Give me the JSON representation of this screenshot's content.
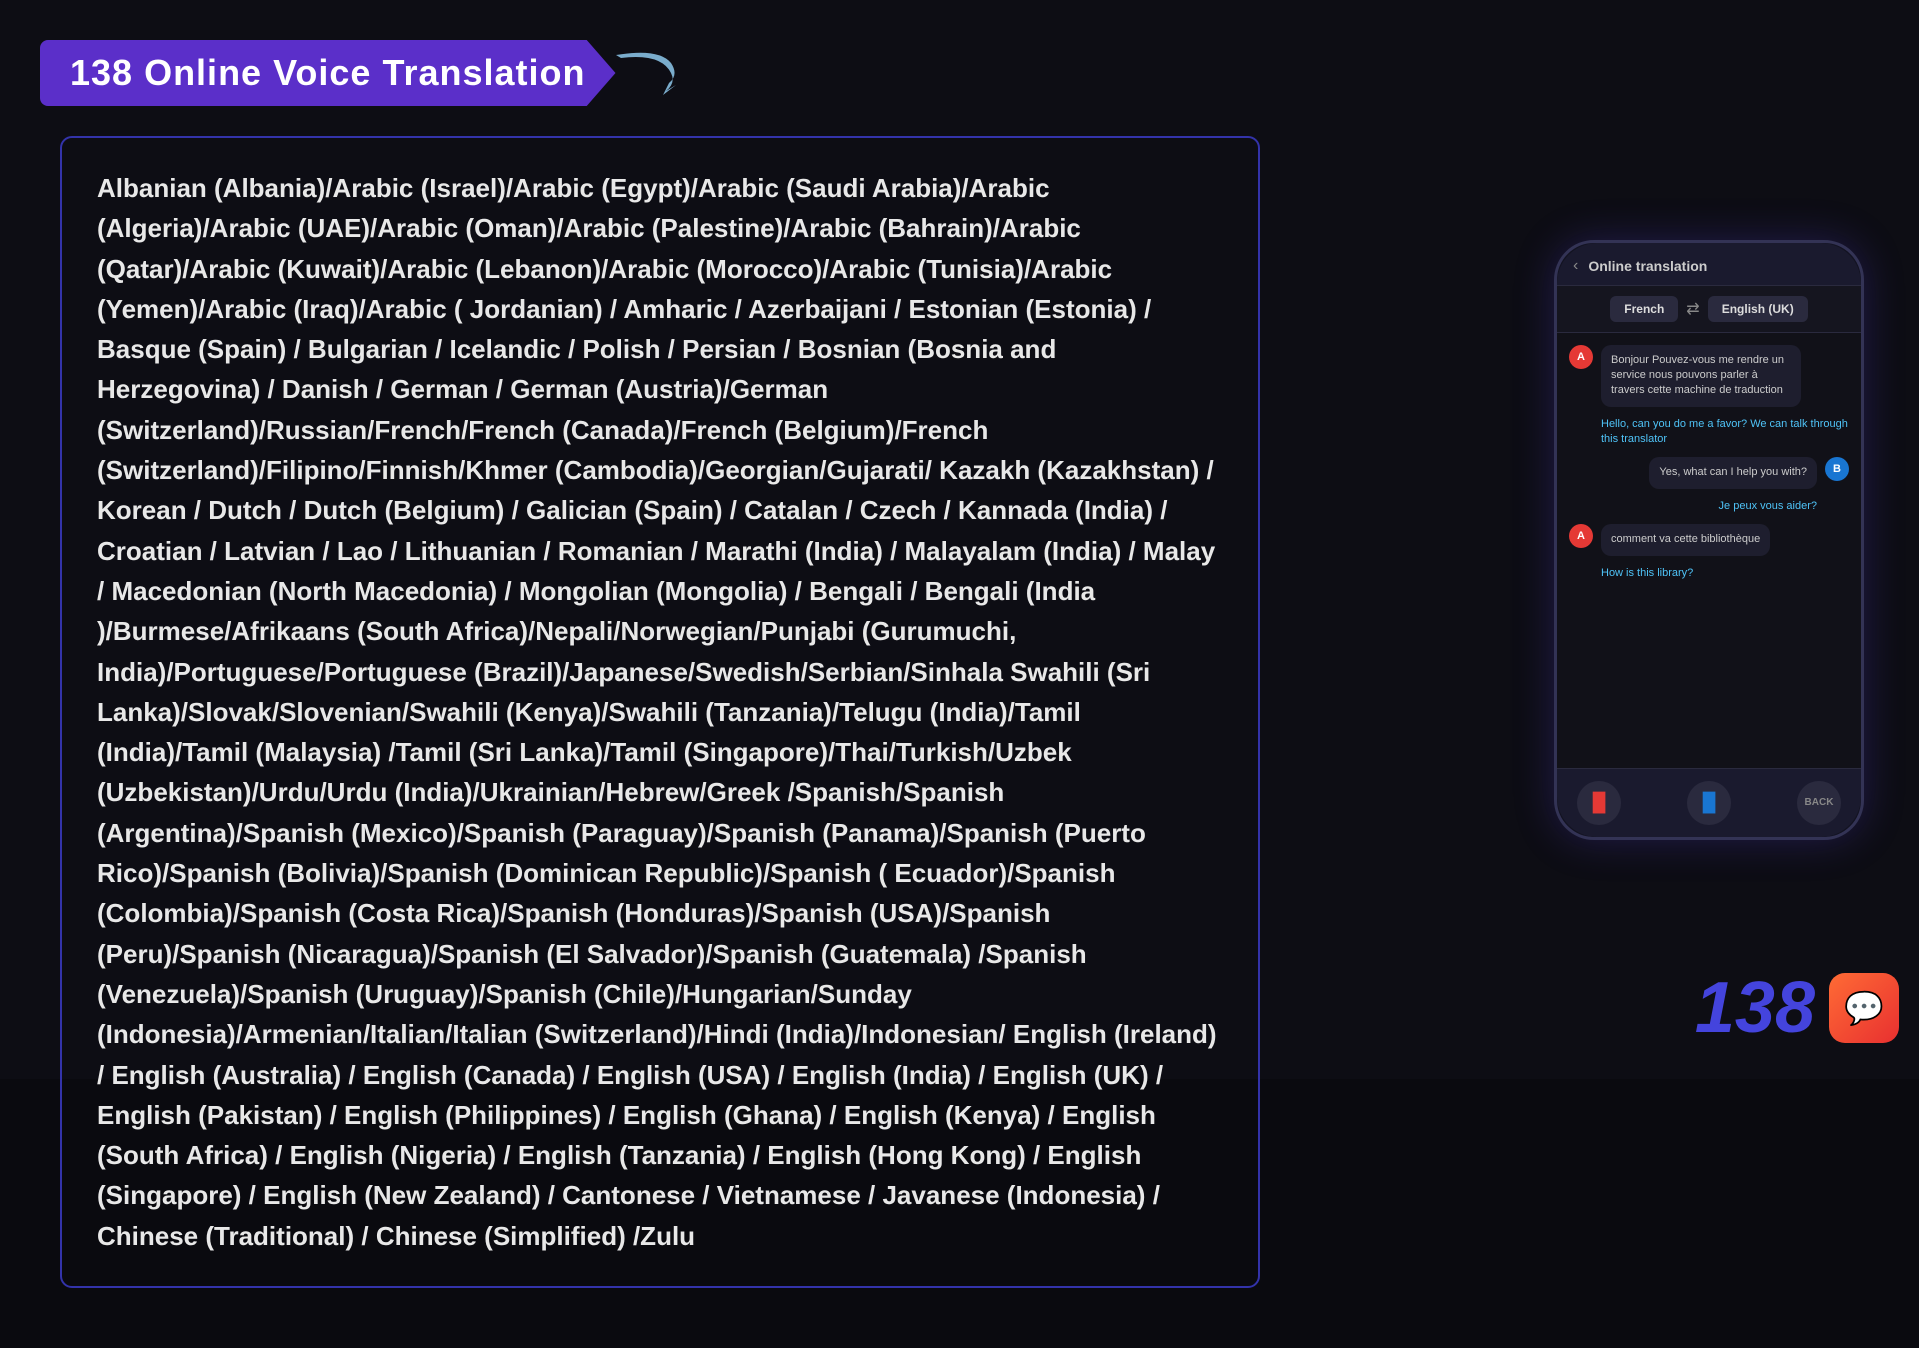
{
  "title": "138 Online Voice Translation",
  "languages_text": "Albanian (Albania)/Arabic (Israel)/Arabic (Egypt)/Arabic (Saudi Arabia)/Arabic (Algeria)/Arabic (UAE)/Arabic (Oman)/Arabic (Palestine)/Arabic (Bahrain)/Arabic (Qatar)/Arabic (Kuwait)/Arabic (Lebanon)/Arabic (Morocco)/Arabic (Tunisia)/Arabic (Yemen)/Arabic (Iraq)/Arabic ( Jordanian) / Amharic / Azerbaijani / Estonian (Estonia) / Basque (Spain) / Bulgarian / Icelandic / Polish / Persian / Bosnian (Bosnia and Herzegovina) / Danish / German / German (Austria)/German (Switzerland)/Russian/French/French (Canada)/French (Belgium)/French (Switzerland)/Filipino/Finnish/Khmer (Cambodia)/Georgian/Gujarati/ Kazakh (Kazakhstan) / Korean / Dutch / Dutch (Belgium) / Galician (Spain) / Catalan / Czech / Kannada (India) / Croatian / Latvian / Lao / Lithuanian / Romanian / Marathi (India) / Malayalam (India) / Malay / Macedonian (North Macedonia) / Mongolian (Mongolia) / Bengali / Bengali (India )/Burmese/Afrikaans (South Africa)/Nepali/Norwegian/Punjabi (Gurumuchi, India)/Portuguese/Portuguese (Brazil)/Japanese/Swedish/Serbian/Sinhala Swahili (Sri Lanka)/Slovak/Slovenian/Swahili (Kenya)/Swahili (Tanzania)/Telugu (India)/Tamil (India)/Tamil (Malaysia) /Tamil (Sri Lanka)/Tamil (Singapore)/Thai/Turkish/Uzbek (Uzbekistan)/Urdu/Urdu (India)/Ukrainian/Hebrew/Greek /Spanish/Spanish (Argentina)/Spanish (Mexico)/Spanish (Paraguay)/Spanish (Panama)/Spanish (Puerto Rico)/Spanish (Bolivia)/Spanish (Dominican Republic)/Spanish ( Ecuador)/Spanish (Colombia)/Spanish (Costa Rica)/Spanish (Honduras)/Spanish (USA)/Spanish (Peru)/Spanish (Nicaragua)/Spanish (El Salvador)/Spanish (Guatemala) /Spanish (Venezuela)/Spanish (Uruguay)/Spanish (Chile)/Hungarian/Sunday (Indonesia)/Armenian/Italian/Italian (Switzerland)/Hindi (India)/Indonesian/ English (Ireland) / English (Australia) / English (Canada) / English (USA) / English (India) / English (UK) / English (Pakistan) / English (Philippines) / English (Ghana) / English (Kenya) / English (South Africa) / English (Nigeria) / English (Tanzania) / English (Hong Kong) / English (Singapore) / English (New Zealand) / Cantonese / Vietnamese / Javanese (Indonesia) / Chinese (Traditional) / Chinese (Simplified) /Zulu",
  "phone": {
    "header_back": "‹",
    "header_title": "Online translation",
    "lang_from": "French",
    "lang_to": "English (UK)",
    "swap_icon": "⇄",
    "messages": [
      {
        "side": "left",
        "avatar": "A",
        "text": "Bonjour Pouvez-vous me rendre un service nous pouvons parler à travers cette machine de traduction",
        "translation": "Hello, can you do me a favor? We can talk through this translator"
      },
      {
        "side": "right",
        "avatar": "B",
        "text": "Yes, what can I help you with?",
        "translation": "Je peux vous aider?"
      },
      {
        "side": "left",
        "avatar": "A",
        "text": "comment va cette bibliothèque",
        "translation": "How is this library?"
      }
    ],
    "ctrl_left_icon": "🎙",
    "ctrl_middle_icon": "🎵",
    "ctrl_back_label": "BACK"
  },
  "brand_number": "138",
  "accent_color": "#5b2fc9",
  "arrow_color": "#6699cc"
}
